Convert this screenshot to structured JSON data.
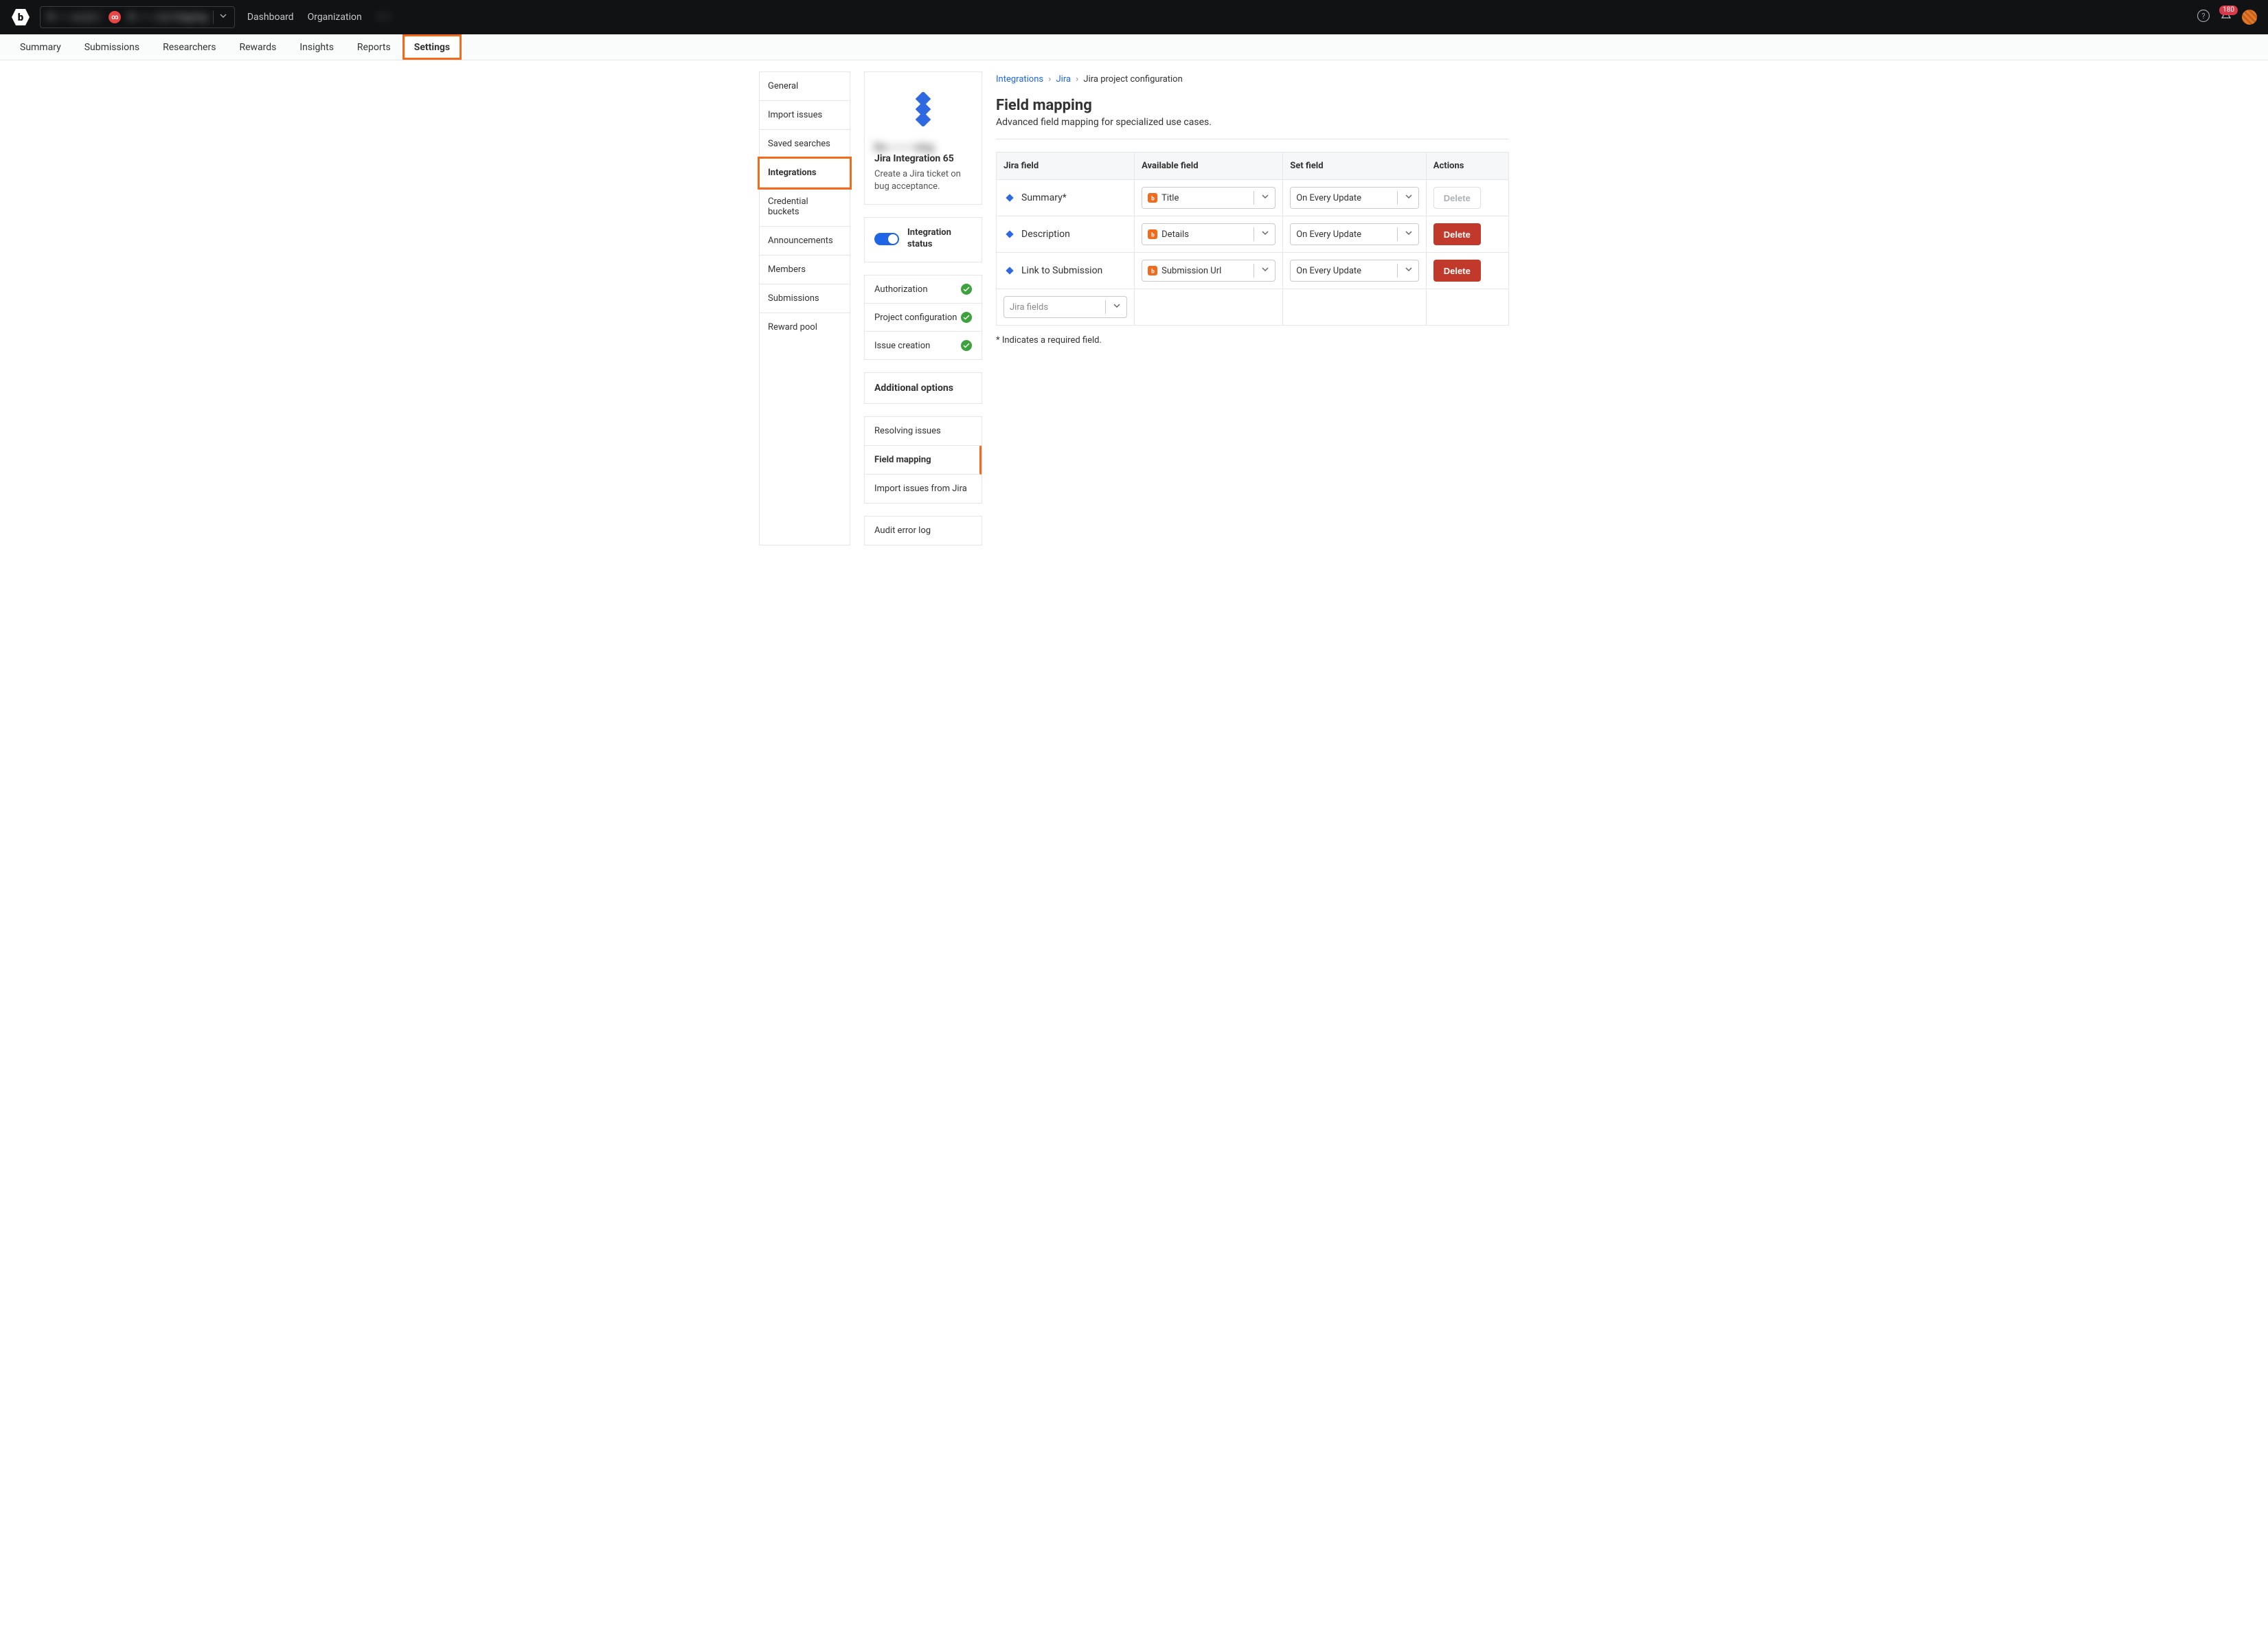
{
  "topbar": {
    "org_picker_text_1": "R———a LLC /",
    "org_picker_text_2": "R——— LLC Ongoing",
    "links": [
      "Dashboard",
      "Organization",
      "——"
    ],
    "notification_count": "180"
  },
  "subnav": {
    "items": [
      "Summary",
      "Submissions",
      "Researchers",
      "Rewards",
      "Insights",
      "Reports",
      "Settings"
    ],
    "active": "Settings"
  },
  "sidebar": {
    "items": [
      "General",
      "Import issues",
      "Saved searches",
      "Integrations",
      "Credential buckets",
      "Announcements",
      "Members",
      "Submissions",
      "Reward pool"
    ],
    "active": "Integrations"
  },
  "integration_card": {
    "title_line1": "Re————oing",
    "title_line2": "Jira Integration 65",
    "desc": "Create a Jira ticket on bug acceptance."
  },
  "status": {
    "label": "Integration status"
  },
  "checklist": [
    "Authorization",
    "Project configuration",
    "Issue creation"
  ],
  "additional_options": {
    "heading": "Additional options",
    "items": [
      "Resolving issues",
      "Field mapping",
      "Import issues from Jira"
    ],
    "active": "Field mapping"
  },
  "audit": {
    "label": "Audit error log"
  },
  "breadcrumb": {
    "a": "Integrations",
    "b": "Jira",
    "c": "Jira project configuration"
  },
  "content": {
    "title": "Field mapping",
    "subtitle": "Advanced field mapping for specialized use cases."
  },
  "table": {
    "headers": [
      "Jira field",
      "Available field",
      "Set field",
      "Actions"
    ],
    "rows": [
      {
        "jira": "Summary*",
        "avail": "Title",
        "set": "On Every Update",
        "action": "Delete",
        "disabled": true
      },
      {
        "jira": "Description",
        "avail": "Details",
        "set": "On Every Update",
        "action": "Delete",
        "disabled": false
      },
      {
        "jira": "Link to Submission",
        "avail": "Submission Url",
        "set": "On Every Update",
        "action": "Delete",
        "disabled": false
      }
    ],
    "add_placeholder": "Jira fields"
  },
  "footnote": "* Indicates a required field."
}
